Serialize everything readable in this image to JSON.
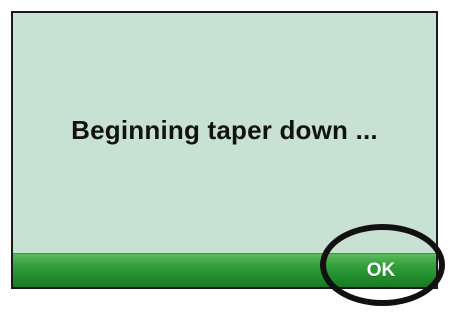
{
  "dialog": {
    "message": "Beginning taper down ...",
    "ok_label": "OK"
  },
  "colors": {
    "screen_background": "#c7e2d3",
    "bar_green": "#2e9b37",
    "highlight_ring": "#111111"
  }
}
